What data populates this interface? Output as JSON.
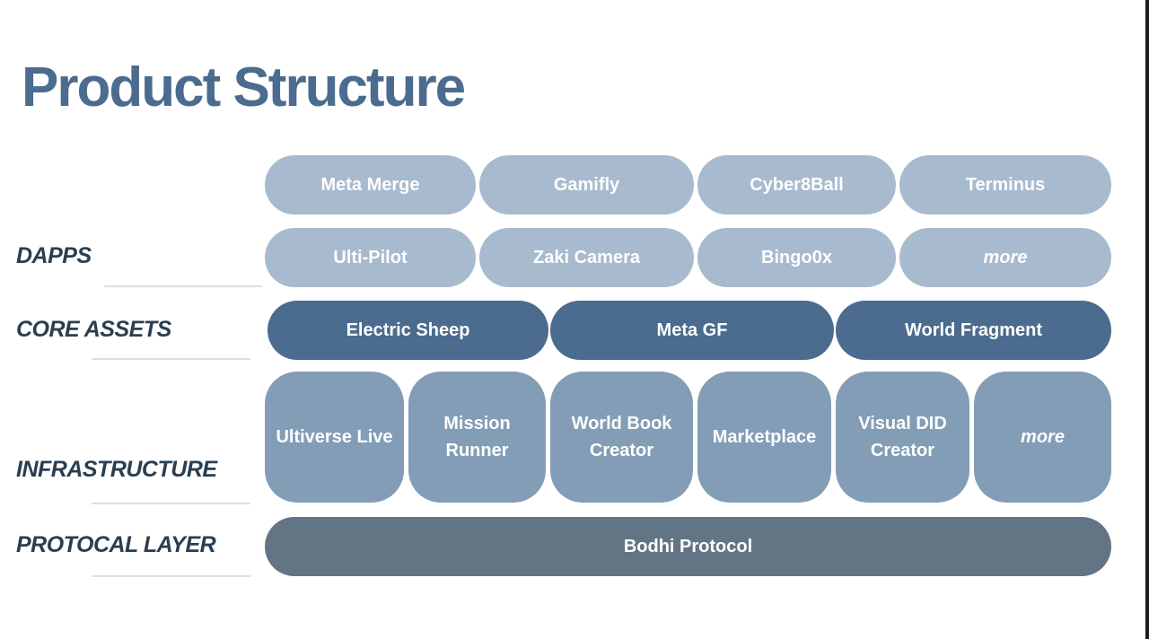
{
  "title": "Product Structure",
  "colors": {
    "title": "#4b6b8f",
    "label": "#2b3e50",
    "dapps": "#a8bace",
    "core_assets": "#4b6b8f",
    "infrastructure": "#839db6",
    "protocol": "#637585",
    "divider": "#dcdfe3"
  },
  "layers": {
    "dapps": {
      "label": "DAPPS",
      "row1": [
        "Meta Merge",
        "Gamifly",
        "Cyber8Ball",
        "Terminus"
      ],
      "row2": [
        "Ulti-Pilot",
        "Zaki Camera",
        "Bingo0x",
        "more"
      ]
    },
    "core_assets": {
      "label": "CORE ASSETS",
      "items": [
        "Electric Sheep",
        "Meta GF",
        "World Fragment"
      ]
    },
    "infrastructure": {
      "label": "INFRASTRUCTURE",
      "items": [
        "Ultiverse Live",
        "Mission Runner",
        "World Book Creator",
        "Marketplace",
        "Visual DID Creator",
        "more"
      ]
    },
    "protocol_layer": {
      "label": "PROTOCAL LAYER",
      "items": [
        "Bodhi Protocol"
      ]
    }
  }
}
